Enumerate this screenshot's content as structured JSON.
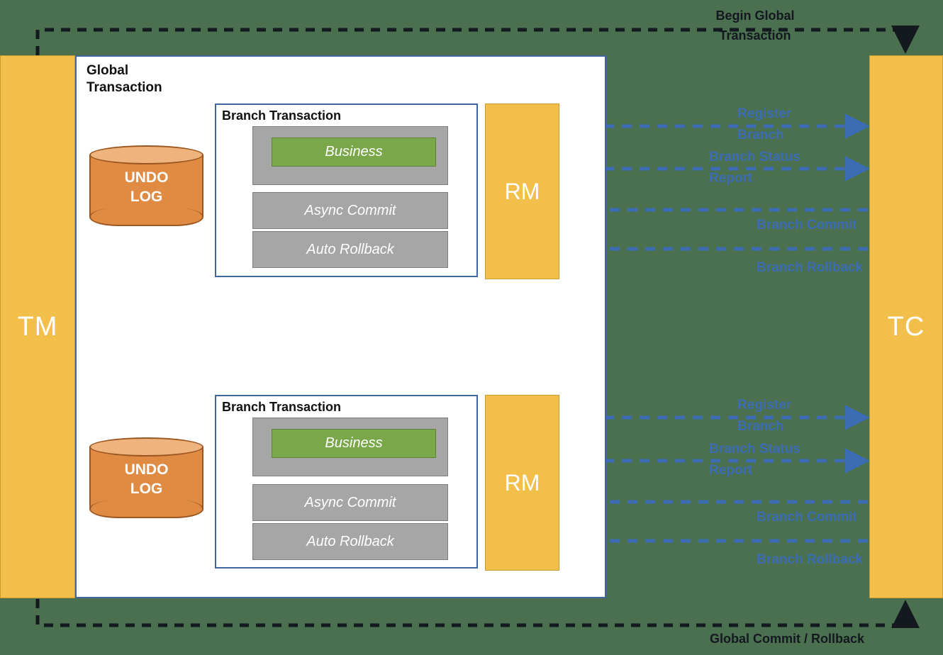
{
  "diagram": {
    "title": "Seata Distributed Transaction Architecture",
    "background_color": "#4a7050"
  },
  "actors": {
    "tm": {
      "label": "TM",
      "color": "#f2c04a"
    },
    "tc": {
      "label": "TC",
      "color": "#f2c04a"
    }
  },
  "global": {
    "title": "Global\nTransaction",
    "title_line1": "Global",
    "title_line2": "Transaction",
    "border_color": "#41669e"
  },
  "outer_flows": {
    "begin": {
      "label_line1": "Begin Global",
      "label_line2": "Transaction"
    },
    "end": {
      "label": "Global Commit / Rollback"
    }
  },
  "branches": [
    {
      "title": "Branch Transaction",
      "rm_label": "RM",
      "store": {
        "line1": "UNDO",
        "line2": "LOG"
      },
      "services": [
        {
          "name": "Business",
          "kind": "green"
        },
        {
          "name": "Async Commit",
          "kind": "gray"
        },
        {
          "name": "Auto Rollback",
          "kind": "gray"
        }
      ],
      "messages": [
        {
          "label_line1": "Register",
          "label_line2": "Branch",
          "direction": "to-tc"
        },
        {
          "label_line1": "Branch Status",
          "label_line2": "Report",
          "direction": "to-tc"
        },
        {
          "label_line1": "Branch Commit",
          "label_line2": "",
          "direction": "to-rm"
        },
        {
          "label_line1": "Branch Rollback",
          "label_line2": "",
          "direction": "to-rm"
        }
      ]
    },
    {
      "title": "Branch Transaction",
      "rm_label": "RM",
      "store": {
        "line1": "UNDO",
        "line2": "LOG"
      },
      "services": [
        {
          "name": "Business",
          "kind": "green"
        },
        {
          "name": "Async Commit",
          "kind": "gray"
        },
        {
          "name": "Auto Rollback",
          "kind": "gray"
        }
      ],
      "messages": [
        {
          "label_line1": "Register",
          "label_line2": "Branch",
          "direction": "to-tc"
        },
        {
          "label_line1": "Branch Status",
          "label_line2": "Report",
          "direction": "to-tc"
        },
        {
          "label_line1": "Branch Commit",
          "label_line2": "",
          "direction": "to-rm"
        },
        {
          "label_line1": "Branch Rollback",
          "label_line2": "",
          "direction": "to-rm"
        }
      ]
    }
  ],
  "colors": {
    "accent_blue": "#3c6cb4",
    "panel_border": "#41669e",
    "gray_box": "#a6a6a6",
    "green_box": "#7aa74a",
    "cylinder": "#e08b43",
    "amber": "#f2c04a"
  }
}
